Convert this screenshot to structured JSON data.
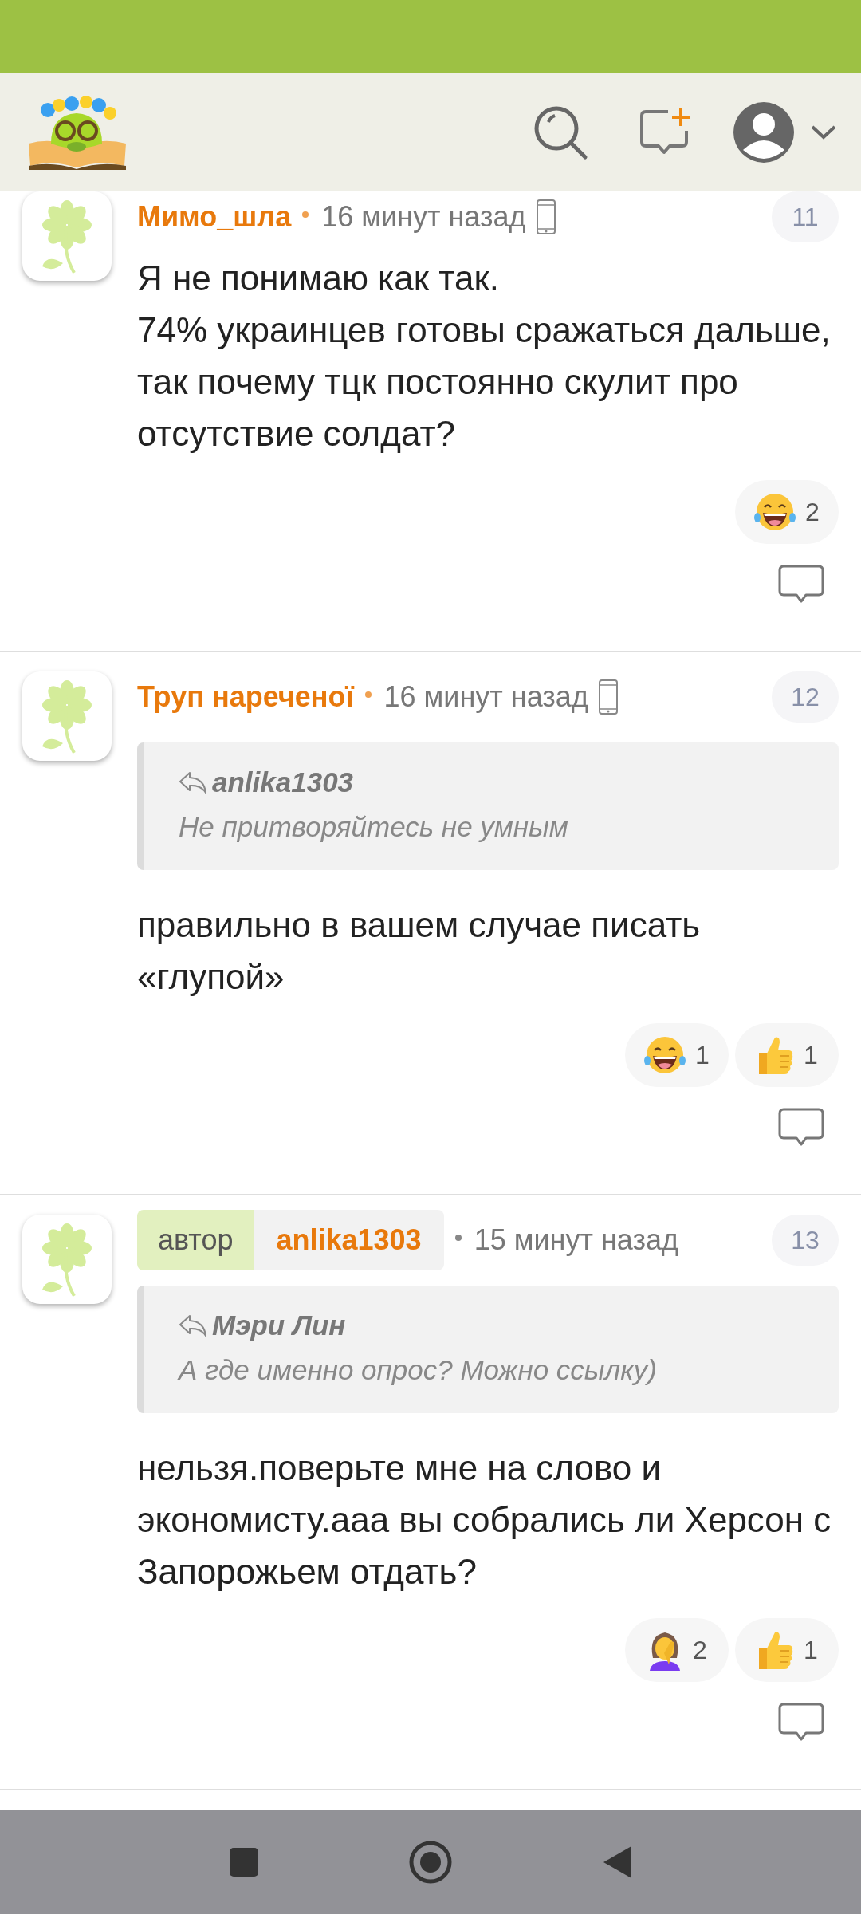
{
  "comments": [
    {
      "number": "11",
      "author": "Мимо_шла",
      "time": "16 минут назад",
      "mobile": true,
      "paragraphs": [
        "Я не понимаю как так.",
        "74% украинцев готовы сражаться дальше, так почему тцк постоянно скулит про отсутствие солдат?"
      ],
      "reactions": [
        {
          "kind": "laugh",
          "count": "2"
        }
      ]
    },
    {
      "number": "12",
      "author": "Труп нареченої",
      "time": "16 минут назад",
      "mobile": true,
      "quote": {
        "author": "anlika1303",
        "text": "Не притворяйтесь не умным"
      },
      "paragraphs": [
        "правильно в вашем случае писать «глупой»"
      ],
      "reactions": [
        {
          "kind": "laugh",
          "count": "1"
        },
        {
          "kind": "thumbs_up",
          "count": "1"
        }
      ]
    },
    {
      "number": "13",
      "author": "anlika1303",
      "author_label": "автор",
      "time": "15 минут назад",
      "mobile": false,
      "quote": {
        "author": "Мэри Лин",
        "text": "А где именно опрос? Можно ссылку)"
      },
      "paragraphs": [
        "нельзя.поверьте мне на слово и экономисту.ааа вы собрались ли Херсон с Запорожьем отдать?"
      ],
      "reactions": [
        {
          "kind": "facepalm",
          "count": "2"
        },
        {
          "kind": "thumbs_up",
          "count": "1"
        }
      ]
    }
  ]
}
